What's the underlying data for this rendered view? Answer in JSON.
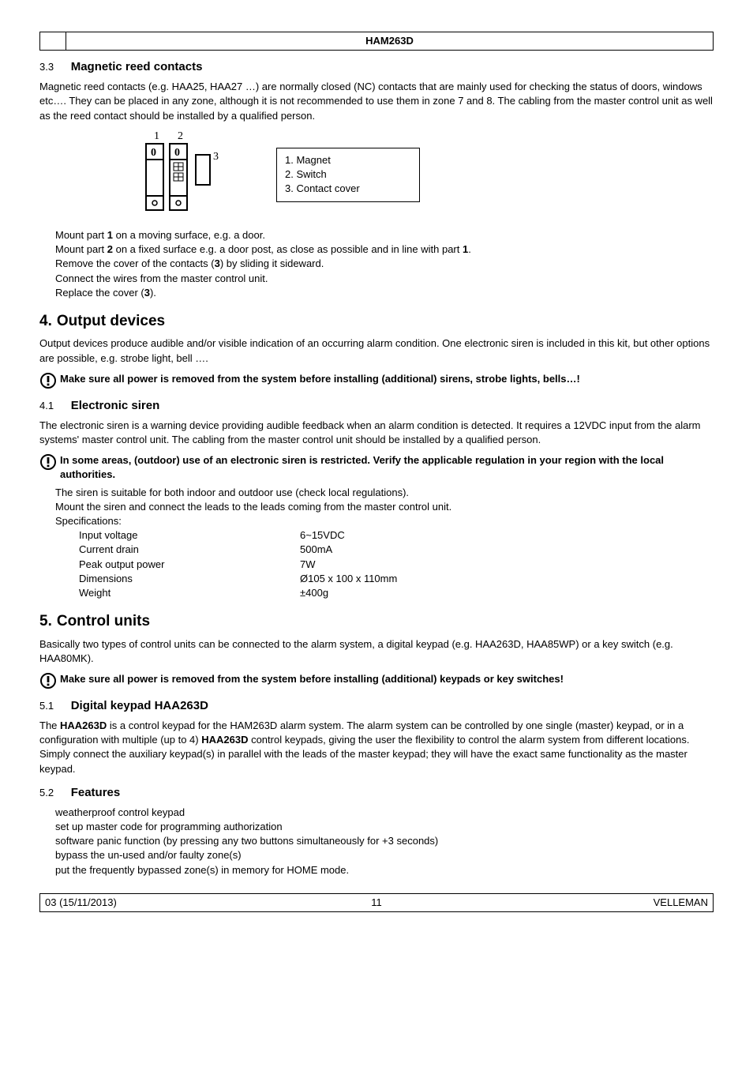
{
  "header": {
    "title": "HAM263D"
  },
  "sec33": {
    "num": "3.3",
    "title": "Magnetic reed contacts",
    "intro": "Magnetic reed contacts (e.g. HAA25, HAA27 …) are normally closed (NC) contacts that are mainly used for checking the status of doors, windows etc…. They can be placed in any zone, although it is not recommended to use them in zone 7 and 8. The cabling from the master control unit as well as the reed contact should be installed by a qualified person.",
    "legend": {
      "l1": "1. Magnet",
      "l2": "2. Switch",
      "l3": "3. Contact cover"
    },
    "steps": {
      "s1a": "Mount part ",
      "s1b": "1",
      "s1c": " on a moving surface, e.g. a door.",
      "s2a": "Mount part ",
      "s2b": "2",
      "s2c": " on a fixed surface e.g. a door post, as close as possible and in line with part ",
      "s2d": "1",
      "s2e": ".",
      "s3a": "Remove the cover of the contacts (",
      "s3b": "3",
      "s3c": ") by sliding it sideward.",
      "s4": "Connect the wires from the master control unit.",
      "s5a": "Replace the cover (",
      "s5b": "3",
      "s5c": ")."
    }
  },
  "sec4": {
    "num": "4.",
    "title": "Output devices",
    "intro": "Output devices produce audible and/or visible indication of an occurring alarm condition. One electronic siren is included in this kit, but other options are possible, e.g. strobe light, bell ….",
    "warn": "Make sure all power is removed from the system before installing (additional) sirens, strobe lights, bells…!"
  },
  "sec41": {
    "num": "4.1",
    "title": "Electronic siren",
    "intro": "The electronic siren is a warning device providing audible feedback when an alarm condition is detected. It requires a 12VDC input from the alarm systems' master control unit. The cabling from the master control unit should be installed by a qualified person.",
    "warn": "In some areas, (outdoor) use of an electronic siren is restricted. Verify the applicable regulation in your region with the local authorities.",
    "note1": "The siren is suitable for both indoor and outdoor use (check local regulations).",
    "note2": "Mount the siren and connect the leads to the leads coming from the master control unit.",
    "note3": "Specifications:",
    "specs": {
      "r1l": "Input voltage",
      "r1v": "6~15VDC",
      "r2l": "Current drain",
      "r2v": "500mA",
      "r3l": "Peak output power",
      "r3v": "7W",
      "r4l": "Dimensions",
      "r4v": "Ø105 x 100 x 110mm",
      "r5l": "Weight",
      "r5v": "±400g"
    }
  },
  "sec5": {
    "num": "5.",
    "title": "Control units",
    "intro": "Basically two types of control units can be connected to the alarm system, a digital keypad (e.g. HAA263D, HAA85WP) or a key switch (e.g. HAA80MK).",
    "warn": "Make sure all power is removed from the system before installing (additional) keypads or key switches!"
  },
  "sec51": {
    "num": "5.1",
    "title": "Digital keypad HAA263D",
    "body_a": "The ",
    "body_b": "HAA263D",
    "body_c": " is a control keypad for the HAM263D alarm system. The alarm system can be controlled by one single (master) keypad, or in a configuration with multiple (up to 4) ",
    "body_d": "HAA263D",
    "body_e": " control keypads, giving the user the flexibility to control the alarm system from different locations. Simply connect the auxiliary keypad(s) in parallel with the leads of the master keypad; they will have the exact same functionality as the master keypad."
  },
  "sec52": {
    "num": "5.2",
    "title": "Features",
    "items": {
      "i1": "weatherproof control keypad",
      "i2": "set up master code for programming authorization",
      "i3": "software panic function (by pressing any two buttons simultaneously for +3 seconds)",
      "i4": "bypass the un-used and/or faulty zone(s)",
      "i5": "put the frequently bypassed zone(s) in memory for HOME mode."
    }
  },
  "footer": {
    "left": "03 (15/11/2013)",
    "mid": "11",
    "right": "VELLEMAN"
  },
  "diagram_labels": {
    "l1": "1",
    "l2": "2",
    "l3": "3"
  }
}
